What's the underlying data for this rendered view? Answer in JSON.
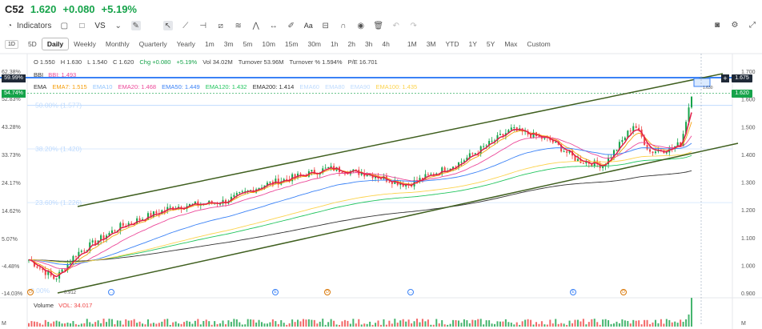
{
  "header": {
    "symbol": "C52",
    "last": "1.620",
    "change": "+0.080",
    "change_pct": "+5.19%"
  },
  "toolbar": {
    "indicators_label": "Indicators",
    "vs_label": "VS",
    "text_label": "Aa"
  },
  "periods": {
    "selector": "1D",
    "items": [
      "5D",
      "Daily",
      "Weekly",
      "Monthly",
      "Quarterly",
      "Yearly",
      "1m",
      "3m",
      "5m",
      "10m",
      "15m",
      "30m",
      "1h",
      "2h",
      "3h",
      "4h",
      "1M",
      "3M",
      "YTD",
      "1Y",
      "5Y",
      "Max",
      "Custom"
    ],
    "active": "Daily"
  },
  "quote": {
    "o": "O 1.550",
    "h": "H 1.630",
    "l": "L 1.540",
    "c": "C 1.620",
    "chg": "Chg +0.080",
    "chgp": "+5.19%",
    "vol": "Vol 34.02M",
    "turnover": "Turnover 53.96M",
    "turnover_pct": "Turnover % 1.594%",
    "pe": "P/E 16.701"
  },
  "bbi": {
    "name": "BBI",
    "value": "BBI: 1.493"
  },
  "ema": {
    "name": "EMA",
    "items": [
      {
        "label": "EMA7: 1.515",
        "color": "#f59e0b"
      },
      {
        "label": "EMA10",
        "color": "#93c5fd"
      },
      {
        "label": "EMA20: 1.468",
        "color": "#ec4899"
      },
      {
        "label": "EMA50: 1.449",
        "color": "#3b82f6"
      },
      {
        "label": "EMA120: 1.432",
        "color": "#22c55e"
      },
      {
        "label": "EMA200: 1.414",
        "color": "#333333"
      },
      {
        "label": "EMA60",
        "color": "#bfdbfe"
      },
      {
        "label": "EMA80",
        "color": "#bfdbfe"
      },
      {
        "label": "EMA90",
        "color": "#bfdbfe"
      },
      {
        "label": "EMA100: 1.435",
        "color": "#fcd34d"
      }
    ]
  },
  "volume": {
    "name": "Volume",
    "value": "VOL: 34.017"
  },
  "fib": {
    "l50": "50.00% (1.577)",
    "l38": "38.20% (1.420)",
    "l23": "23.60% (1.226)",
    "l0": "0.00%"
  },
  "low_label": "0.912",
  "hi_label": "1.630",
  "left_axis": [
    "62.38%",
    "52.83%",
    "43.28%",
    "33.73%",
    "24.17%",
    "14.62%",
    "5.07%",
    "-4.48%",
    "-14.03%"
  ],
  "right_axis": [
    "1.700",
    "1.600",
    "1.500",
    "1.400",
    "1.300",
    "1.200",
    "1.100",
    "1.000",
    "0.900"
  ],
  "tags": {
    "pct_top": "59.99%",
    "pct_cur": "54.74%",
    "price_top": "1.675",
    "price_cur": "1.620"
  },
  "events": [
    {
      "type": "D",
      "color": "#d97706"
    },
    {
      "type": "...",
      "color": "#3b82f6"
    },
    {
      "type": "E",
      "color": "#3b82f6"
    },
    {
      "type": "D",
      "color": "#d97706"
    },
    {
      "type": "...",
      "color": "#3b82f6"
    },
    {
      "type": "E",
      "color": "#3b82f6"
    },
    {
      "type": "D",
      "color": "#d97706"
    }
  ],
  "vol_axis": "M"
}
